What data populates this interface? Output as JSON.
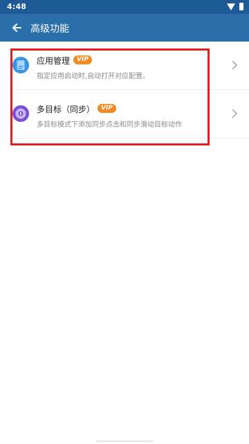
{
  "status_bar": {
    "time": "4:48",
    "wifi_icon": "wifi-icon",
    "battery_icon": "battery-icon"
  },
  "app_bar": {
    "title": "高级功能",
    "back_icon": "arrow-left-icon"
  },
  "features": [
    {
      "title": "应用管理",
      "badge": "VIP",
      "subtitle": "指定应用启动时,自动打开对应配置。",
      "icon": "app-manager-icon"
    },
    {
      "title": "多目标（同步）",
      "badge": "VIP",
      "subtitle": "多目标模式下添加同步点击和同步滑动目标动作",
      "icon": "multi-target-icon"
    }
  ],
  "colors": {
    "status_bar": "#1e5a96",
    "app_bar": "#2b6faa",
    "vip_badge": "#f08a24",
    "highlight": "#e0201e"
  }
}
